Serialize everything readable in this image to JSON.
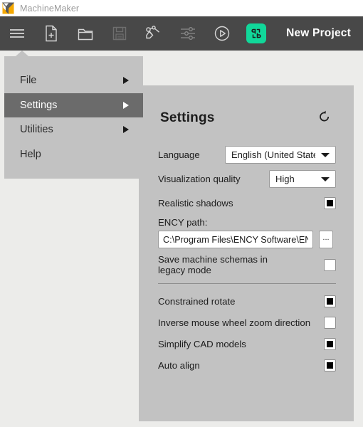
{
  "window": {
    "title": "MachineMaker",
    "logo_icon": "machinemaker-logo-icon"
  },
  "toolbar": {
    "items": [
      {
        "name": "hamburger-menu-button",
        "icon": "hamburger-icon"
      },
      {
        "name": "new-file-button",
        "icon": "new-document-icon"
      },
      {
        "name": "open-folder-button",
        "icon": "folder-icon"
      },
      {
        "name": "save-button",
        "icon": "floppy-disk-icon"
      },
      {
        "name": "robot-arm-button",
        "icon": "robot-arm-icon"
      },
      {
        "name": "settings-sliders-button",
        "icon": "sliders-icon"
      },
      {
        "name": "play-button",
        "icon": "play-circle-icon"
      },
      {
        "name": "ency-button",
        "icon": "ency-logo-icon"
      }
    ],
    "project_name": "New Project",
    "accent_green": "#11d89a",
    "bar_color": "#484848"
  },
  "menu": {
    "items": [
      {
        "label": "File",
        "has_submenu": true,
        "selected": false
      },
      {
        "label": "Settings",
        "has_submenu": true,
        "selected": true
      },
      {
        "label": "Utilities",
        "has_submenu": true,
        "selected": false
      },
      {
        "label": "Help",
        "has_submenu": false,
        "selected": false
      }
    ]
  },
  "settings": {
    "title": "Settings",
    "reset_icon": "reset-arrow-icon",
    "language": {
      "label": "Language",
      "value": "English (United States)",
      "options": [
        "English (United States)"
      ]
    },
    "visualization_quality": {
      "label": "Visualization quality",
      "value": "High",
      "options": [
        "High"
      ]
    },
    "realistic_shadows": {
      "label": "Realistic shadows",
      "checked": true
    },
    "ency_path": {
      "label": "ENCY path:",
      "value": "C:\\Program Files\\ENCY Software\\ENCY",
      "browse_label": "..."
    },
    "legacy_mode": {
      "label": "Save machine schemas in legacy mode",
      "checked": false
    },
    "constrained_rotate": {
      "label": "Constrained rotate",
      "checked": true
    },
    "inverse_zoom": {
      "label": "Inverse mouse wheel zoom direction",
      "checked": false
    },
    "simplify_cad": {
      "label": "Simplify CAD models",
      "checked": true
    },
    "auto_align": {
      "label": "Auto align",
      "checked": true
    }
  }
}
